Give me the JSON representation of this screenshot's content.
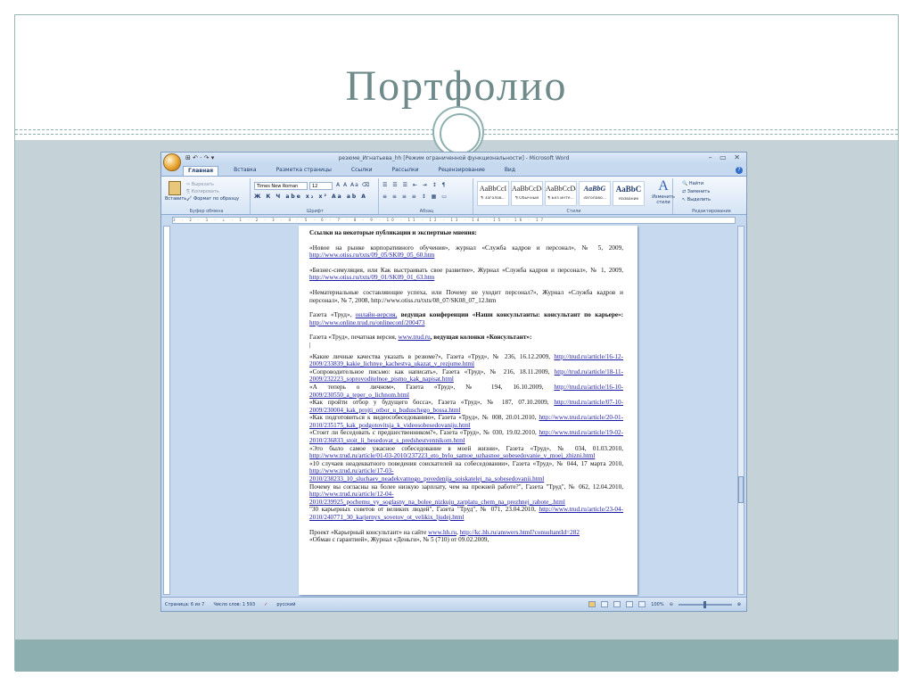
{
  "slide": {
    "title": "Портфолио"
  },
  "word": {
    "title": "резюме_Игнатьева_hh [Режим ограниченной функциональности] - Microsoft Word",
    "qat": "⊞ ↶ · ↷ ▾",
    "tabs": [
      "Главная",
      "Вставка",
      "Разметка страницы",
      "Ссылки",
      "Рассылки",
      "Рецензирование",
      "Вид"
    ],
    "ribbon": {
      "clipboard": {
        "label": "Буфер обмена",
        "paste": "Вставить",
        "cut": "Вырезать",
        "copy": "Копировать",
        "format_painter": "Формат по образцу"
      },
      "font": {
        "label": "Шрифт",
        "name": "Times New Roman",
        "size": "12",
        "row1_tools": "A A Aa ⌫",
        "row2_tools": "Ж К Ч abe x₂ x² Aa ab A"
      },
      "paragraph": {
        "label": "Абзац",
        "row1_tools": "☰ ☰ ☰ ⇤ ⇥ ↕ ¶",
        "row2_tools": "≡ ≡ ≡ ≡ ↕ ▦ ▭"
      },
      "styles": {
        "label": "Стили",
        "items": [
          {
            "sample": "AaBbCcI",
            "name": "¶ Заголов..."
          },
          {
            "sample": "AaBbCcDc",
            "name": "¶ Обычный"
          },
          {
            "sample": "AaBbCcDc",
            "name": "¶ Без инте..."
          },
          {
            "sample": "AaBbG",
            "name": "Заголово..."
          },
          {
            "sample": "AaBbC",
            "name": "Название"
          }
        ],
        "change_styles": "Изменить стили"
      },
      "editing": {
        "label": "Редактирование",
        "find": "Найти",
        "replace": "Заменить",
        "select": "Выделить"
      }
    },
    "ruler_text": "3 · 2 · 1 · ⊥ · 1 · 2 · 3 · 4 · 5 · 6 · 7 · 8 · 9 · 10 · 11 · 12 · 13 · 14 · 15 · 16 · 17",
    "document": {
      "heading": "Ссылки на некоторые публикации и экспертные мнения:",
      "pub1_text": "«Новое на рынке корпоративного обучения», журнал «Служба кадров и персонал», № 5, 2009,",
      "pub1_link": "http://www.otiss.ru/txts/09_05/SK09_05_60.htm",
      "pub2_text": "«Бизнес-симуляция, или Как выстраивать свое развитие», Журнал «Служба кадров и персонал», № 1, 2009,",
      "pub2_link": "http://www.otiss.ru/txts/09_01/SK09_01_63.htm",
      "pub3_text": "«Нематериальные составляющие успеха, или Почему не уходит персонал?», Журнал «Служба кадров и персонал», № 7, 2008, http://www.otiss.ru/txts/08_07/SK08_07_12.htm",
      "trud1_pre": "Газета «Труд»,",
      "trud1_online": "онлайн-версия,",
      "trud1_bold": "ведущая конференции «Наши консультанты: консультант по карьере»:",
      "trud1_link": "http://www.online.trud.ru/onlineconf/200473",
      "trud2_pre": "Газета «Труд», печатная версия,",
      "trud2_link": "www.trud.ru",
      "trud2_bold": ", ведущая колонки «Консультант»:",
      "articles": [
        {
          "text": "«Какие личные качества указать в резюме?», Газета «Труд», № 236, 16.12.2009,",
          "link": "http://trud.ru/article/16-12-2009/233839_kakie_lichnye_kachestva_ukazat_v_rezjume.html"
        },
        {
          "text": "«Сопроводительное письмо: как написать», Газета «Труд», № 216, 18.11.2009,",
          "link": "http://trud.ru/article/18-11-2009/232223_soprovoditelnoe_pismo_kak_napisat.html"
        },
        {
          "text": "«А теперь о личном», Газета «Труд», № 194, 16.10.2009,",
          "link": "http://trud.ru/article/16-10-2009/230550_a_teper_o_lichnom.html"
        },
        {
          "text": "«Как пройти отбор у будущего босса», Газета «Труд», № 187, 07.10.2009,",
          "link": "http://trud.ru/article/07-10-2009/230004_kak_projti_otbor_u_buduschego_bossa.html"
        },
        {
          "text": "«Как подготовиться к видеособеседованию», Газета «Труд», № 008, 20.01.2010,",
          "link": "http://www.trud.ru/article/20-01-2010/235175_kak_podgotovitsja_k_videosobesedovaniju.html"
        },
        {
          "text": "«Стоит ли беседовать с предшественником?», Газета «Труд», № 030, 19.02.2010,",
          "link": "http://www.trud.ru/article/19-02-2010/236833_stoit_li_besedovat_s_predshestvennikom.html"
        },
        {
          "text": "«Это было самое ужасное собеседование в моей жизни», Газета «Труд», № 034, 01.03.2010,",
          "link": "http://www.trud.ru/article/01-03-2010/237223_eto_bylo_samoe_uzhasnoe_sobesedovanie_v_moej_zhizni.html"
        },
        {
          "text": "«10 случаев неадекватного поведения соискателей на собеседовании», Газета «Труд», № 044, 17 марта 2010,",
          "link": "http://www.trud.ru/article/17-03-2010/238233_10_sluchaev_neadekvatnogo_povedenija_soiskatelej_na_sobesedovanii.html"
        },
        {
          "text": "Почему вы согласны на более низкую зарплату, чем на прежней работе?\", Газета \"Труд\", № 062, 12.04.2010,",
          "link": "http://www.trud.ru/article/12-04-2010/239925_pochemu_vy_soglasny_na_bolee_nizkuju_zarplatu_chem_na_prezhnej_rabote_.html"
        },
        {
          "text": "\"30 карьерных советов от великих людей\", Газета \"Труд\", № 071, 23.04.2010,",
          "link": "http://www.trud.ru/article/23-04-2010/240771_30_karjernyx_sovetov_ot_velikix_ljudej.html"
        }
      ],
      "project_text": "Проект «Карьерный консультант» на сайте",
      "project_link1": "www.hh.ru",
      "project_link2": "http://kc.hh.ru/answers.html?consultantId=282",
      "last_line": "«Обман с гарантией», Журнал «Деньги», № 5 (710) от 09.02.2009,"
    },
    "status": {
      "page": "Страница: 6 из 7",
      "words": "Число слов: 1 593",
      "lang": "русский",
      "zoom": "100%"
    }
  }
}
